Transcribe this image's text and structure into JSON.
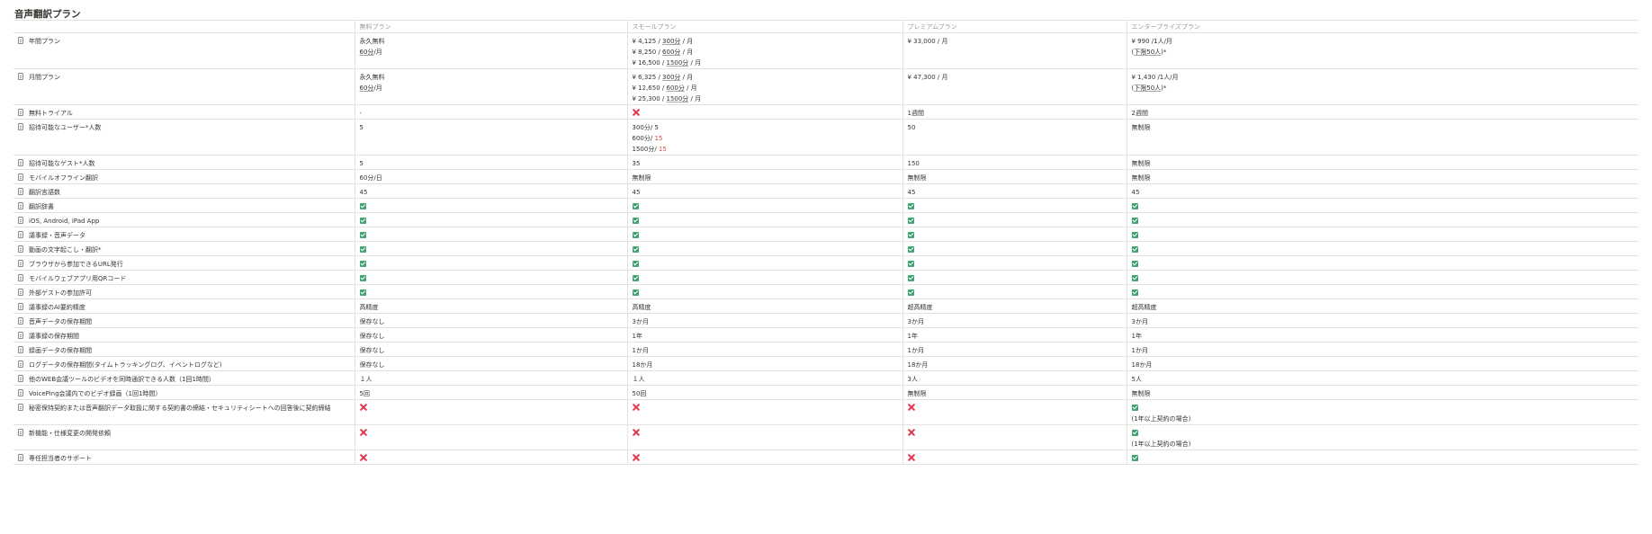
{
  "page_title": "音声翻訳プラン",
  "columns": [
    "",
    "無料プラン",
    "スモールプラン",
    "プレミアムプラン",
    "エンタープライズプラン"
  ],
  "icons": {
    "row_icon": "document-icon",
    "yes": "check-icon",
    "no": "cross-icon"
  },
  "colors": {
    "check": "#3ea36d",
    "cross": "#e0354b"
  },
  "rows": [
    {
      "label": "年間プラン",
      "height": 37,
      "cells": [
        [
          {
            "t": "永久無料"
          },
          {
            "t": "60分",
            "u": true,
            "s": "/月"
          }
        ],
        [
          {
            "p": "¥ 4,125 / ",
            "t": "300分",
            "u": true,
            "s": " / 月"
          },
          {
            "p": "¥ 8,250 / ",
            "t": "600分",
            "u": true,
            "s": " / 月"
          },
          {
            "p": "¥ 16,500 / ",
            "t": "1500分",
            "u": true,
            "s": " / 月"
          }
        ],
        [
          {
            "t": "¥ 33,000 / 月"
          }
        ],
        [
          {
            "t": "¥ 990 /1人/月"
          },
          {
            "p": "(",
            "t": "下限50人",
            "u": true,
            "s": ")*"
          }
        ]
      ]
    },
    {
      "label": "月間プラン",
      "height": 37,
      "cells": [
        [
          {
            "t": "永久無料"
          },
          {
            "t": "60分",
            "u": true,
            "s": "/月"
          }
        ],
        [
          {
            "p": "¥ 6,325 / ",
            "t": "300分",
            "u": true,
            "s": " / 月"
          },
          {
            "p": "¥ 12,650 / ",
            "t": "600分",
            "u": true,
            "s": " / 月"
          },
          {
            "p": "¥ 25,300 / ",
            "t": "1500分",
            "u": true,
            "s": " / 月"
          }
        ],
        [
          {
            "t": "¥ 47,300 / 月"
          }
        ],
        [
          {
            "t": "¥ 1,430 /1人/月"
          },
          {
            "p": "(",
            "t": "下限50人",
            "u": true,
            "s": ")*"
          }
        ]
      ]
    },
    {
      "label": "無料トライアル",
      "height": 16,
      "cells": [
        [
          {
            "t": "-"
          }
        ],
        [
          {
            "icon": "no"
          }
        ],
        [
          {
            "t": "1週間"
          }
        ],
        [
          {
            "t": "2週間"
          }
        ]
      ]
    },
    {
      "label": "招待可能なユーザー*人数",
      "height": 37,
      "cells": [
        [
          {
            "t": "5"
          }
        ],
        [
          {
            "t": "300分/ 5"
          },
          {
            "p": "600分/ ",
            "t": "15",
            "h": true
          },
          {
            "p": "1500分/ ",
            "t": "15",
            "h": true
          }
        ],
        [
          {
            "t": "50"
          }
        ],
        [
          {
            "t": "無制限"
          }
        ]
      ]
    },
    {
      "label": "招待可能なゲスト*人数",
      "height": 16,
      "cells": [
        [
          {
            "t": "5"
          }
        ],
        [
          {
            "t": "35"
          }
        ],
        [
          {
            "t": "150"
          }
        ],
        [
          {
            "t": "無制限"
          }
        ]
      ]
    },
    {
      "label": "モバイルオフライン翻訳",
      "height": 16,
      "cells": [
        [
          {
            "t": "60分/日"
          }
        ],
        [
          {
            "t": "無制限"
          }
        ],
        [
          {
            "t": "無制限"
          }
        ],
        [
          {
            "t": "無制限"
          }
        ]
      ]
    },
    {
      "label": "翻訳言語数",
      "height": 16,
      "cells": [
        [
          {
            "t": "45"
          }
        ],
        [
          {
            "t": "45"
          }
        ],
        [
          {
            "t": "45"
          }
        ],
        [
          {
            "t": "45"
          }
        ]
      ]
    },
    {
      "label": "翻訳辞書",
      "height": 16,
      "cells": [
        [
          {
            "icon": "yes"
          }
        ],
        [
          {
            "icon": "yes"
          }
        ],
        [
          {
            "icon": "yes"
          }
        ],
        [
          {
            "icon": "yes"
          }
        ]
      ]
    },
    {
      "label": "iOS, Android, iPad App",
      "height": 16,
      "cells": [
        [
          {
            "icon": "yes"
          }
        ],
        [
          {
            "icon": "yes"
          }
        ],
        [
          {
            "icon": "yes"
          }
        ],
        [
          {
            "icon": "yes"
          }
        ]
      ]
    },
    {
      "label": "議事録・音声データ",
      "height": 16,
      "cells": [
        [
          {
            "icon": "yes"
          }
        ],
        [
          {
            "icon": "yes"
          }
        ],
        [
          {
            "icon": "yes"
          }
        ],
        [
          {
            "icon": "yes"
          }
        ]
      ]
    },
    {
      "label": "動画の文字起こし・翻訳*",
      "height": 16,
      "cells": [
        [
          {
            "icon": "yes"
          }
        ],
        [
          {
            "icon": "yes"
          }
        ],
        [
          {
            "icon": "yes"
          }
        ],
        [
          {
            "icon": "yes"
          }
        ]
      ]
    },
    {
      "label": "ブラウザから参加できるURL発行",
      "height": 16,
      "cells": [
        [
          {
            "icon": "yes"
          }
        ],
        [
          {
            "icon": "yes"
          }
        ],
        [
          {
            "icon": "yes"
          }
        ],
        [
          {
            "icon": "yes"
          }
        ]
      ]
    },
    {
      "label": "モバイルウェブアプリ用QRコード",
      "height": 16,
      "cells": [
        [
          {
            "icon": "yes"
          }
        ],
        [
          {
            "icon": "yes"
          }
        ],
        [
          {
            "icon": "yes"
          }
        ],
        [
          {
            "icon": "yes"
          }
        ]
      ]
    },
    {
      "label": "外部ゲストの参加許可",
      "height": 16,
      "cells": [
        [
          {
            "icon": "yes"
          }
        ],
        [
          {
            "icon": "yes"
          }
        ],
        [
          {
            "icon": "yes"
          }
        ],
        [
          {
            "icon": "yes"
          }
        ]
      ]
    },
    {
      "label": "議事録のAI要約精度",
      "height": 16,
      "cells": [
        [
          {
            "t": "高精度"
          }
        ],
        [
          {
            "t": "高精度"
          }
        ],
        [
          {
            "t": " 超高精度"
          }
        ],
        [
          {
            "t": " 超高精度"
          }
        ]
      ]
    },
    {
      "label": "音声データの保存期間",
      "height": 16,
      "cells": [
        [
          {
            "t": "保存なし"
          }
        ],
        [
          {
            "t": "3か月"
          }
        ],
        [
          {
            "t": "3か月"
          }
        ],
        [
          {
            "t": "3か月"
          }
        ]
      ]
    },
    {
      "label": "議事録の保存期間",
      "height": 16,
      "cells": [
        [
          {
            "t": "保存なし"
          }
        ],
        [
          {
            "t": "1年"
          }
        ],
        [
          {
            "t": "1年"
          }
        ],
        [
          {
            "t": "1年"
          }
        ]
      ]
    },
    {
      "label": "録画データの保存期間",
      "height": 16,
      "cells": [
        [
          {
            "t": "保存なし"
          }
        ],
        [
          {
            "t": "1か月"
          }
        ],
        [
          {
            "t": "1か月"
          }
        ],
        [
          {
            "t": "1か月"
          }
        ]
      ]
    },
    {
      "label": "ログデータの保存期間(タイムトラッキングログ、イベントログなど)",
      "height": 16,
      "cells": [
        [
          {
            "t": "保存なし"
          }
        ],
        [
          {
            "t": "18か月"
          }
        ],
        [
          {
            "t": "18か月"
          }
        ],
        [
          {
            "t": "18か月"
          }
        ]
      ]
    },
    {
      "label": "他のWEB会議ツールのビデオを同時通訳できる人数（1回1時間）",
      "height": 16,
      "cells": [
        [
          {
            "t": "１人"
          }
        ],
        [
          {
            "t": "１人"
          }
        ],
        [
          {
            "t": "3人"
          }
        ],
        [
          {
            "t": "5人"
          }
        ]
      ]
    },
    {
      "label": "VoicePing会議内でのビデオ録画（1回1時間）",
      "height": 16,
      "cells": [
        [
          {
            "t": "5回"
          }
        ],
        [
          {
            "t": "50回"
          }
        ],
        [
          {
            "t": "無制限"
          }
        ],
        [
          {
            "t": "無制限"
          }
        ]
      ]
    },
    {
      "label": "秘密保持契約または音声翻訳データ取扱に関する契約書の締結・セキュリティシートへの回答後に契約締結",
      "height": 27,
      "cells": [
        [
          {
            "icon": "no"
          }
        ],
        [
          {
            "icon": "no"
          }
        ],
        [
          {
            "icon": "no"
          }
        ],
        [
          {
            "icon": "yes"
          },
          {
            "t": "(1年以上契約の場合)"
          }
        ]
      ]
    },
    {
      "label": "新機能・仕様変更の開発依頼",
      "height": 27,
      "cells": [
        [
          {
            "icon": "no"
          }
        ],
        [
          {
            "icon": "no"
          }
        ],
        [
          {
            "icon": "no"
          }
        ],
        [
          {
            "icon": "yes"
          },
          {
            "t": "(1年以上契約の場合)"
          }
        ]
      ]
    },
    {
      "label": "専任担当者のサポート",
      "height": 16,
      "cells": [
        [
          {
            "icon": "no"
          }
        ],
        [
          {
            "icon": "no"
          }
        ],
        [
          {
            "icon": "no"
          }
        ],
        [
          {
            "icon": "yes"
          }
        ]
      ]
    }
  ]
}
